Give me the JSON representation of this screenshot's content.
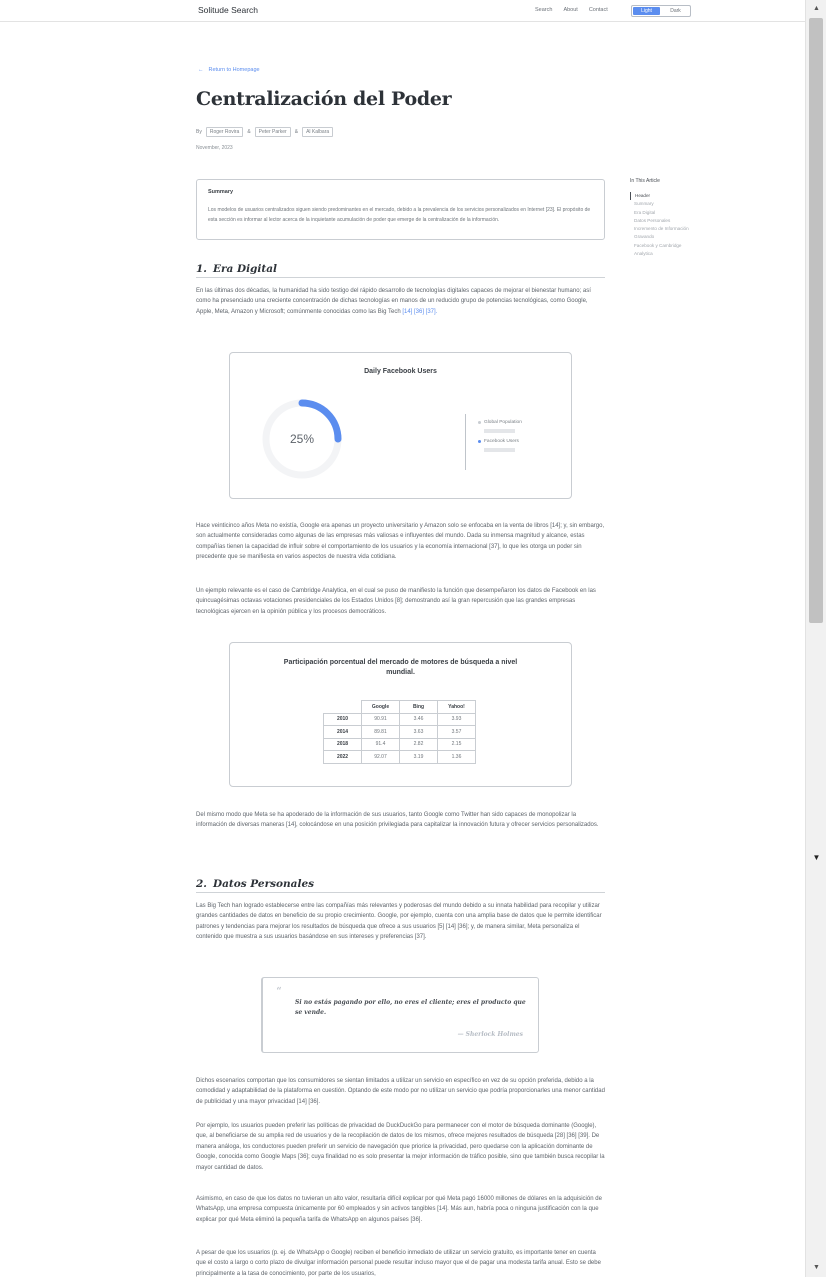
{
  "nav": {
    "brand": "Solitude Search",
    "links": [
      "Search",
      "About",
      "Contact"
    ],
    "theme": {
      "light": "Light",
      "dark": "Dark",
      "selected": "Light"
    }
  },
  "back_link": "Return to Homepage",
  "article": {
    "title": "Centralización del Poder",
    "by_label": "By",
    "authors": [
      "Roger Rovira",
      "Peter Parker",
      "Al Kalbara"
    ],
    "author_sep": "&",
    "date": "November, 2023"
  },
  "summary": {
    "heading": "Summary",
    "text": "Los modelos de usuarios centralizados siguen siendo predominantes en el mercado, debido a la prevalencia de los servicios personalizados en Internet [23]. El propósito de esta sección es informar al lector acerca de la inquietante acumulación de poder que emerge de la centralización de la información."
  },
  "toc": {
    "title": "In This Article",
    "items": [
      "Header",
      "Summary",
      "Era Digital",
      "Datos Personales",
      "Incremento de Información",
      "Gravando",
      "Facebook y Cambridge",
      "Analytica"
    ],
    "active": "Header"
  },
  "sections": {
    "s1": {
      "num": "1.",
      "title": "Era Digital"
    },
    "s2": {
      "num": "2.",
      "title": "Datos Personales"
    }
  },
  "paragraphs": {
    "p1": "En las últimas dos décadas, la humanidad ha sido testigo del rápido desarrollo de tecnologías digitales capaces de mejorar el bienestar humano; así como ha presenciado una creciente concentración de dichas tecnologías en manos de un reducido grupo de potencias tecnológicas, como Google, Apple, Meta, Amazon y Microsoft; comúnmente conocidas como las Big Tech",
    "p1_cites": "[14] [36] [37].",
    "p2": "Hace veinticinco años Meta no existía, Google era apenas un proyecto universitario y Amazon solo se enfocaba en la venta de libros [14]; y, sin embargo, son actualmente consideradas como algunas de las empresas más valiosas e influyentes del mundo. Dada su inmensa magnitud y alcance, estas compañías tienen la capacidad de influir sobre el comportamiento de los usuarios y la economía internacional [37], lo que les otorga un poder sin precedente que se manifiesta en varios aspectos de nuestra vida cotidiana.",
    "p3": "Un ejemplo relevante es el caso de Cambridge Analytica, en el cual se puso de manifiesto la función que desempeñaron los datos de Facebook en las quincuagésimas octavas votaciones presidenciales de los Estados Unidos [8]; demostrando así la gran repercusión que las grandes empresas tecnológicas ejercen en la opinión pública y los procesos democráticos.",
    "p4": "Del mismo modo que Meta se ha apoderado de la información de sus usuarios, tanto Google como Twitter han sido capaces de monopolizar la información de diversas maneras [14], colocándose en una posición privilegiada para capitalizar la innovación futura y ofrecer servicios personalizados.",
    "p5": "Las Big Tech han logrado establecerse entre las compañías más relevantes y poderosas del mundo debido a su innata habilidad para recopilar y utilizar grandes cantidades de datos en beneficio de su propio crecimiento. Google, por ejemplo, cuenta con una amplia base de datos que le permite identificar patrones y tendencias para mejorar los resultados de búsqueda que ofrece a sus usuarios [5] [14] [36]; y, de manera similar, Meta personaliza el contenido que muestra a sus usuarios basándose en sus intereses y preferencias [37].",
    "p6": "Dichos escenarios comportan que los consumidores se sientan limitados a utilizar un servicio en específico en vez de su opción preferida, debido a la comodidad y adaptabilidad de la plataforma en cuestión. Optando de este modo por no utilizar un servicio que podría proporcionarles una menor cantidad de publicidad y una mayor privacidad [14] [36].",
    "p7": "Por ejemplo, los usuarios pueden preferir las políticas de privacidad de DuckDuckGo para permanecer con el motor de búsqueda dominante (Google), que, al beneficiarse de su amplia red de usuarios y de la recopilación de datos de los mismos, ofrece mejores resultados de búsqueda [28] [36] [39]. De manera análoga, los conductores pueden preferir un servicio de navegación que priorice la privacidad, pero quedarse con la aplicación dominante de Google, conocida como Google Maps [36]; cuya finalidad no es solo presentar la mejor información de tráfico posible, sino que también busca recopilar la mayor cantidad de datos.",
    "p8": "Asimismo, en caso de que los datos no tuvieran un alto valor, resultaría difícil explicar por qué Meta pagó 16000 millones de dólares en la adquisición de WhatsApp, una empresa compuesta únicamente por 60 empleados y sin activos tangibles [14]. Más aun, habría poca o ninguna justificación con la que explicar por qué Meta eliminó la pequeña tarifa de WhatsApp en algunos países [36].",
    "p9": "A pesar de que los usuarios (p. ej. de WhatsApp o Google) reciben el beneficio inmediato de utilizar un servicio gratuito, es importante tener en cuenta que el costo a largo o corto plazo de divulgar información personal puede resultar incluso mayor que el de pagar una modesta tarifa anual. Esto se debe principalmente a la tasa de conocimiento, por parte de los usuarios,"
  },
  "donut_chart": {
    "title": "Daily Facebook Users",
    "center_label": "25%",
    "legend": [
      {
        "name": "Global Population",
        "color": "#c9cdd2"
      },
      {
        "name": "Facebook Users",
        "color": "#5b8def"
      }
    ]
  },
  "quote": {
    "mark": "“",
    "text": "Si no estás pagando por ello, no eres el cliente; eres el producto que se vende.",
    "author": "— Sherlock Holmes"
  },
  "chart_data": [
    {
      "type": "pie",
      "title": "Daily Facebook Users",
      "categories": [
        "Facebook Users",
        "Global Population"
      ],
      "values": [
        25,
        75
      ],
      "legend": "right"
    },
    {
      "type": "table",
      "title": "Participación porcentual del mercado de motores de búsqueda a nivel mundial.",
      "columns": [
        "Google",
        "Bing",
        "Yahoo!"
      ],
      "rows": [
        {
          "label": "2010",
          "values": [
            90.91,
            3.46,
            3.93
          ]
        },
        {
          "label": "2014",
          "values": [
            89.81,
            3.63,
            3.57
          ]
        },
        {
          "label": "2018",
          "values": [
            91.4,
            2.82,
            2.15
          ]
        },
        {
          "label": "2022",
          "values": [
            92.07,
            3.19,
            1.36
          ]
        }
      ]
    }
  ]
}
